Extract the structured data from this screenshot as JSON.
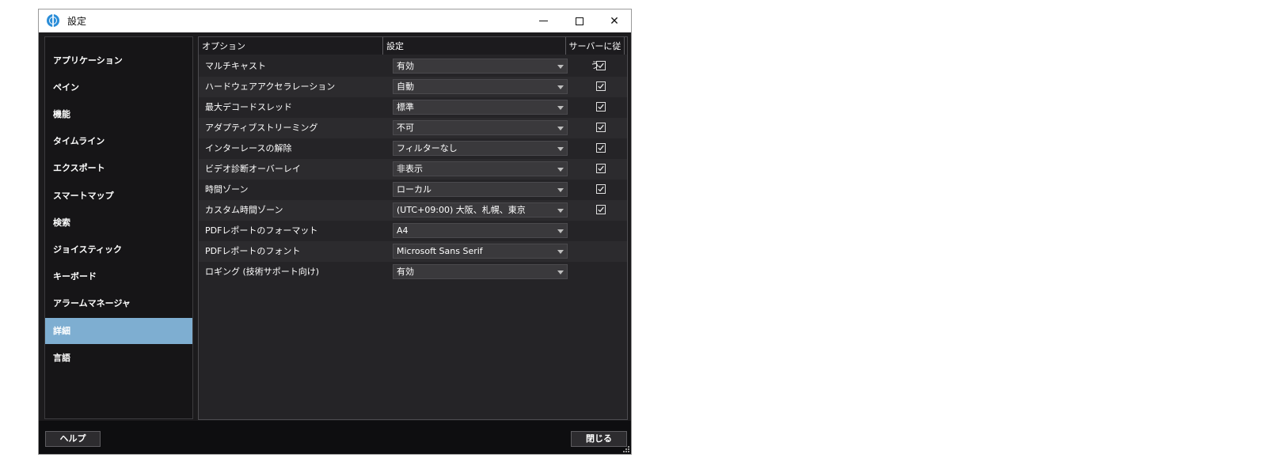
{
  "window": {
    "title": "設定",
    "controls": {
      "minimize": "─",
      "maximize": "□",
      "close": "✕"
    }
  },
  "sidebar": {
    "items": [
      {
        "label": "アプリケーション",
        "active": false
      },
      {
        "label": "ペイン",
        "active": false
      },
      {
        "label": "機能",
        "active": false
      },
      {
        "label": "タイムライン",
        "active": false
      },
      {
        "label": "エクスポート",
        "active": false
      },
      {
        "label": "スマートマップ",
        "active": false
      },
      {
        "label": "検索",
        "active": false
      },
      {
        "label": "ジョイスティック",
        "active": false
      },
      {
        "label": "キーボード",
        "active": false
      },
      {
        "label": "アラームマネージャ",
        "active": false
      },
      {
        "label": "詳細",
        "active": true
      },
      {
        "label": "言語",
        "active": false
      }
    ]
  },
  "table": {
    "columns": {
      "option": "オプション",
      "setting": "設定",
      "follow_server": "サーバーに従う"
    },
    "rows": [
      {
        "option": "マルチキャスト",
        "value": "有効",
        "follow_server": true
      },
      {
        "option": "ハードウェアアクセラレーション",
        "value": "自動",
        "follow_server": true
      },
      {
        "option": "最大デコードスレッド",
        "value": "標準",
        "follow_server": true
      },
      {
        "option": "アダプティブストリーミング",
        "value": "不可",
        "follow_server": true
      },
      {
        "option": "インターレースの解除",
        "value": "フィルターなし",
        "follow_server": true
      },
      {
        "option": "ビデオ診断オーバーレイ",
        "value": "非表示",
        "follow_server": true
      },
      {
        "option": "時間ゾーン",
        "value": "ローカル",
        "follow_server": true
      },
      {
        "option": "カスタム時間ゾーン",
        "value": "(UTC+09:00) 大阪、札幌、東京",
        "follow_server": true
      },
      {
        "option": "PDFレポートのフォーマット",
        "value": "A4",
        "follow_server": null
      },
      {
        "option": "PDFレポートのフォント",
        "value": "Microsoft Sans Serif",
        "follow_server": null
      },
      {
        "option": "ロギング (技術サポート向け)",
        "value": "有効",
        "follow_server": null
      }
    ]
  },
  "footer": {
    "help_label": "ヘルプ",
    "close_label": "閉じる"
  },
  "colors": {
    "active_item": "#7eaed1",
    "window_bg": "#1c1b1d",
    "panel_bg": "#252427"
  }
}
